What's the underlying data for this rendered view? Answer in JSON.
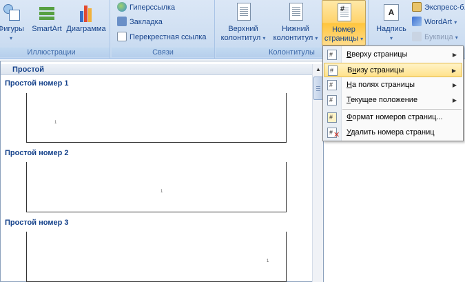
{
  "ribbon": {
    "illustrations": {
      "label": "Иллюстрации",
      "shapes": "Фигуры",
      "smartart": "SmartArt",
      "chart": "Диаграмма"
    },
    "links": {
      "label": "Связи",
      "hyperlink": "Гиперссылка",
      "bookmark": "Закладка",
      "cross_ref": "Перекрестная ссылка"
    },
    "headers": {
      "label": "Колонтитулы",
      "header_line1": "Верхний",
      "header_line2": "колонтитул",
      "footer_line1": "Нижний",
      "footer_line2": "колонтитул",
      "page_number_line1": "Номер",
      "page_number_line2": "страницы"
    },
    "text": {
      "textbox": "Надпись",
      "express": "Экспресс-б...",
      "wordart": "WordArt",
      "dropcap": "Буквица"
    }
  },
  "gallery": {
    "header": "Простой",
    "items": [
      {
        "title": "Простой номер 1",
        "page_num": "1"
      },
      {
        "title": "Простой номер 2",
        "page_num": "1"
      },
      {
        "title": "Простой номер 3",
        "page_num": "1"
      }
    ]
  },
  "menu": {
    "items": [
      {
        "prefix": "",
        "hot": "В",
        "rest": "верху страницы",
        "arrow": true
      },
      {
        "prefix": "В",
        "hot": "н",
        "rest": "изу страницы",
        "arrow": true
      },
      {
        "prefix": "",
        "hot": "Н",
        "rest": "а полях страницы",
        "arrow": true
      },
      {
        "prefix": "",
        "hot": "Т",
        "rest": "екущее положение",
        "arrow": true
      },
      {
        "prefix": "",
        "hot": "Ф",
        "rest": "ормат номеров страниц...",
        "arrow": false
      },
      {
        "prefix": "",
        "hot": "У",
        "rest": "далить номера страниц",
        "arrow": false
      }
    ]
  },
  "colors": {
    "ribbon_text": "#15428b",
    "highlight": "#ffe28a",
    "selected_button": "#ffd36b"
  }
}
